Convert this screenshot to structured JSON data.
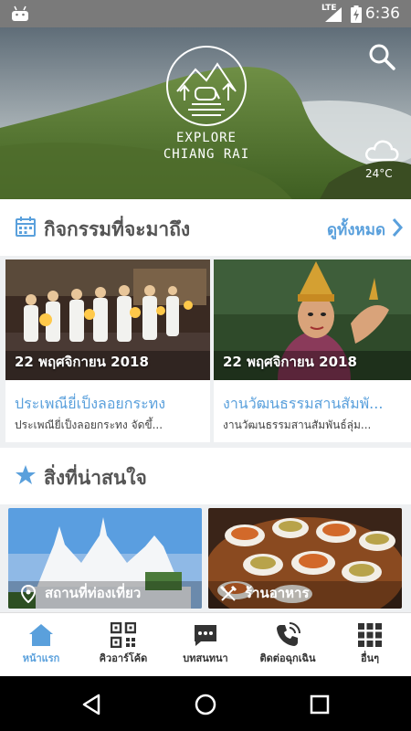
{
  "status_bar": {
    "time": "6:36",
    "network": "LTE"
  },
  "hero": {
    "logo_line1": "EXPLORE",
    "logo_line2": "CHIANG RAI",
    "temperature": "24°C",
    "weather_icon": "cloud-icon",
    "search_icon": "search-icon"
  },
  "events_section": {
    "title": "กิจกรรมที่จะมาถึง",
    "see_all": "ดูทั้งหมด",
    "icon": "calendar-icon",
    "cards": [
      {
        "date": "22 พฤศจิกายน 2018",
        "title": "ประเพณียี่เป็งลอยกระทง",
        "desc": "ประเพณียี่เป็งลอยกระทง จัดขึ้..."
      },
      {
        "date": "22 พฤศจิกายน 2018",
        "title": "งานวัฒนธรรมสานสัมพั...",
        "desc": "งานวัฒนธรรมสานสัมพันธ์ลุ่ม..."
      }
    ]
  },
  "attractions_section": {
    "title": "สิ่งที่น่าสนใจ",
    "icon": "star-icon",
    "items": [
      {
        "label": "สถานที่ท่องเที่ยว",
        "icon": "map-pin-icon"
      },
      {
        "label": "ร้านอาหาร",
        "icon": "utensils-icon"
      }
    ]
  },
  "bottom_nav": {
    "items": [
      {
        "label": "หน้าแรก",
        "icon": "home-icon",
        "active": true
      },
      {
        "label": "คิวอาร์โค้ด",
        "icon": "qr-code-icon",
        "active": false
      },
      {
        "label": "บทสนทนา",
        "icon": "chat-icon",
        "active": false
      },
      {
        "label": "ติดต่อฉุกเฉิน",
        "icon": "phone-icon",
        "active": false
      },
      {
        "label": "อื่นๆ",
        "icon": "grid-icon",
        "active": false
      }
    ]
  },
  "colors": {
    "accent": "#5aa0dc",
    "status_bar": "#7a7a7a",
    "section_bg": "#eef0f2"
  }
}
